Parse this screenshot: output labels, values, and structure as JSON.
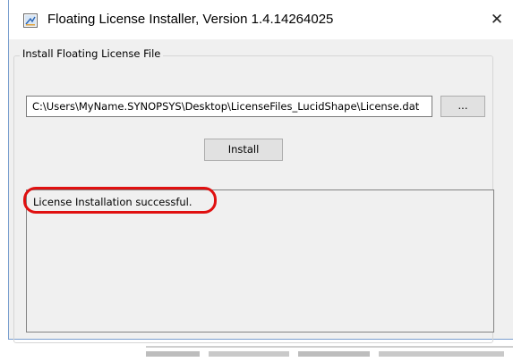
{
  "window": {
    "title": "Floating License Installer, Version 1.4.14264025",
    "close_glyph": "✕",
    "app_icon": "license-installer-icon"
  },
  "group": {
    "legend": "Install Floating License File"
  },
  "license_file": {
    "path": "C:\\Users\\MyName.SYNOPSYS\\Desktop\\LicenseFiles_LucidShape\\License.dat"
  },
  "buttons": {
    "browse_label": "...",
    "install_label": "Install"
  },
  "log": {
    "lines": [
      "License Installation successful."
    ]
  },
  "annotation": {
    "highlight_color": "#e01010"
  }
}
